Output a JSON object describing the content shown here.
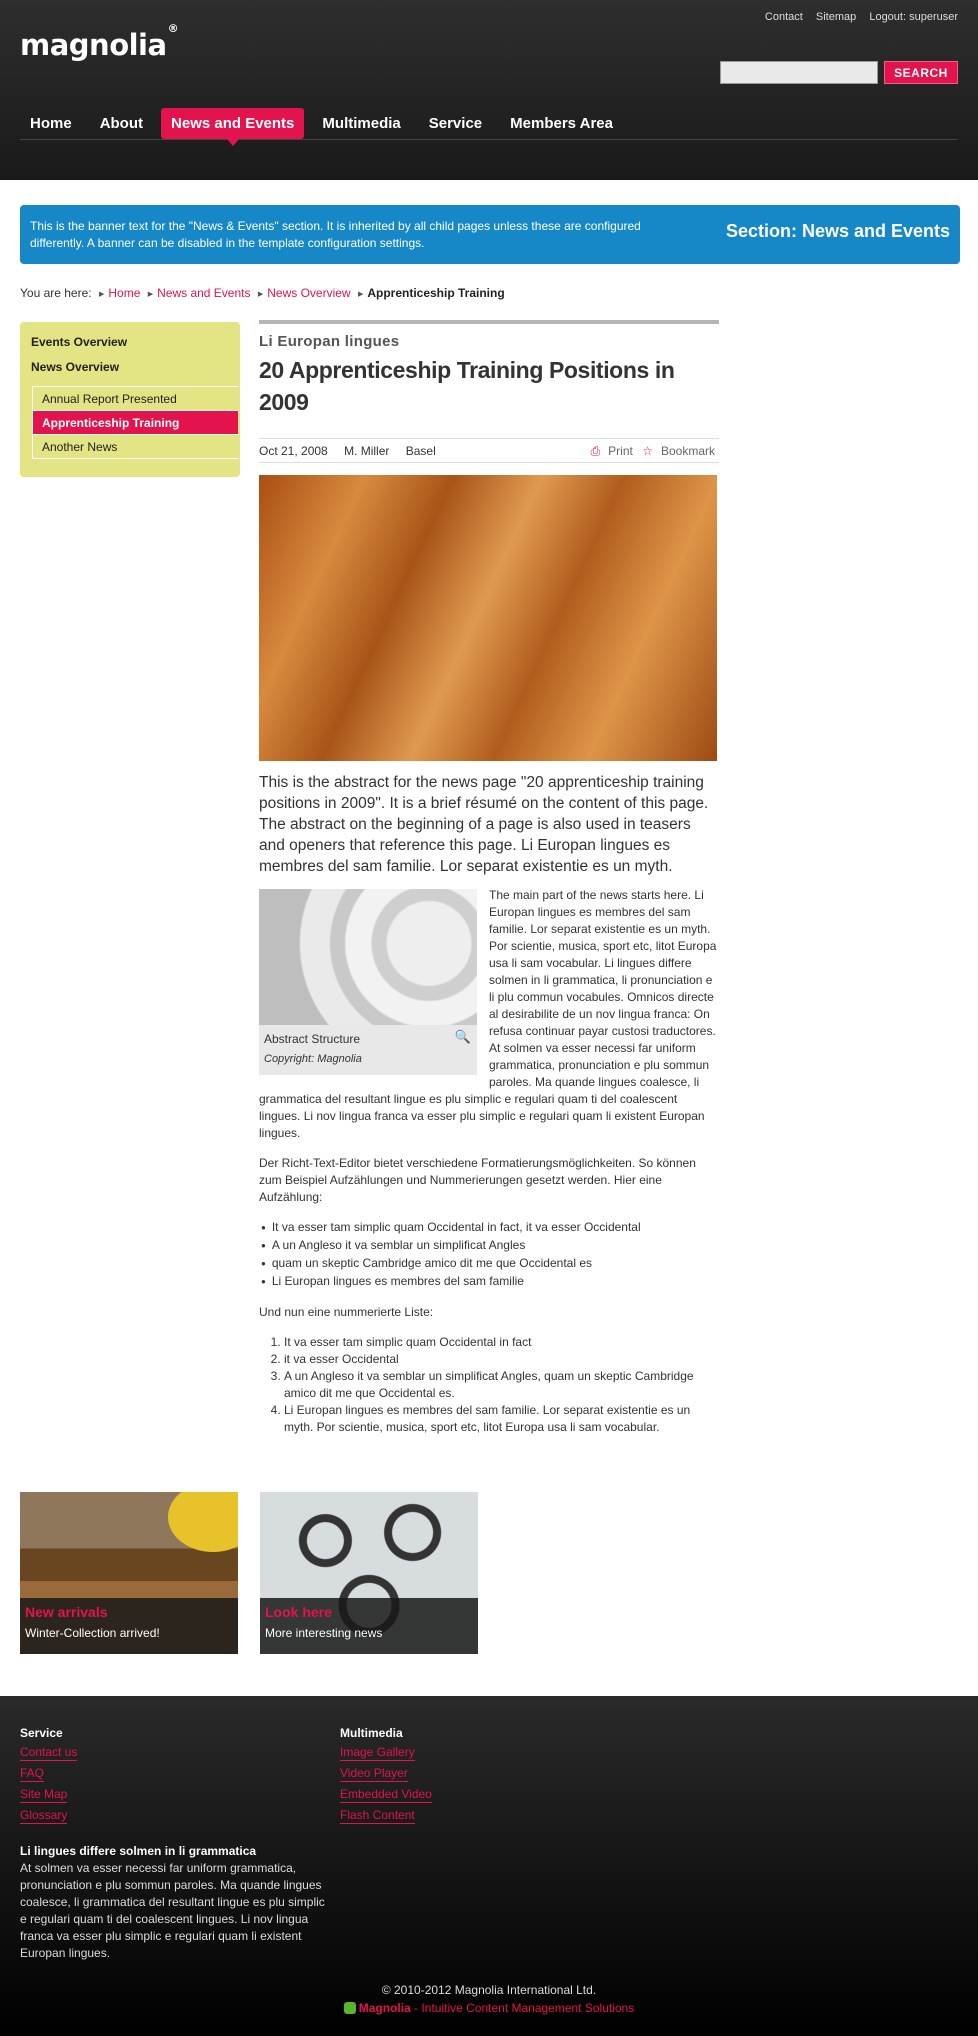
{
  "header": {
    "logo": "magnolia",
    "logo_mark": "®",
    "meta_nav": [
      "Contact",
      "Sitemap",
      "Logout: superuser"
    ],
    "search": {
      "placeholder": "",
      "button": "SEARCH"
    },
    "nav": [
      {
        "label": "Home",
        "active": false
      },
      {
        "label": "About",
        "active": false
      },
      {
        "label": "News and Events",
        "active": true
      },
      {
        "label": "Multimedia",
        "active": false
      },
      {
        "label": "Service",
        "active": false
      },
      {
        "label": "Members Area",
        "active": false
      }
    ]
  },
  "banner": {
    "text": "This is the banner text for the \"News & Events\" section. It is inherited by all child pages unless these are configured differently. A banner can be disabled in the template configuration settings.",
    "section": "Section: News and Events"
  },
  "breadcrumb": {
    "prefix": "You are here:",
    "links": [
      "Home",
      "News and Events",
      "News Overview"
    ],
    "current": "Apprenticeship Training"
  },
  "subnav": {
    "top": [
      "Events Overview",
      "News Overview"
    ],
    "items": [
      "Annual Report Presented",
      "Apprenticeship Training",
      "Another News"
    ],
    "active_index": 1
  },
  "article": {
    "kicker": "Li Europan lingues",
    "title": "20 Apprenticeship Training Positions in 2009",
    "date": "Oct 21, 2008",
    "author": "M. Miller",
    "location": "Basel",
    "print": "Print",
    "bookmark": "Bookmark",
    "abstract": "This is the abstract for the news page \"20 apprenticeship training positions in 2009\". It is a brief résumé on the content of this page. The abstract on the beginning of a page is also used in teasers and openers that reference this page. Li Europan lingues es membres del sam familie. Lor separat existentie es un myth.",
    "figure": {
      "caption": "Abstract Structure",
      "copyright": "Copyright: Magnolia"
    },
    "para1": "The main part of the news starts here. Li Europan lingues es membres del sam familie. Lor separat existentie es un myth. Por scientie, musica, sport etc, litot Europa usa li sam vocabular. Li lingues differe solmen in li grammatica, li pronunciation e li plu commun vocabules. Omnicos directe al desirabilite de un nov lingua franca: On refusa continuar payar custosi traductores. At solmen va esser necessi far uniform grammatica, pronunciation e plu sommun paroles. Ma quande lingues coalesce, li grammatica del resultant lingue es plu simplic e regulari quam ti del coalescent lingues. Li nov lingua franca va esser plu simplic e regulari quam li existent Europan lingues.",
    "para2": "Der Richt-Text-Editor bietet verschiedene Formatierungsmöglichkeiten. So können zum Beispiel Aufzählungen und Nummerierungen gesetzt werden. Hier eine Aufzählung:",
    "bullets": [
      "It va esser tam simplic quam Occidental in fact, it va esser Occidental",
      "A un Angleso it va semblar un simplificat Angles",
      "quam un skeptic Cambridge amico dit me que Occidental es",
      "Li Europan lingues es membres del sam familie"
    ],
    "para3": "Und nun eine nummerierte Liste:",
    "numbered": [
      "It va esser tam simplic quam Occidental in fact",
      "it va esser Occidental",
      "A un Angleso it va semblar un simplificat Angles, quam un skeptic Cambridge amico dit me que Occidental es.",
      "Li Europan lingues es membres del sam familie. Lor separat existentie es un myth. Por scientie, musica, sport etc, litot Europa usa li sam vocabular."
    ]
  },
  "teasers": [
    {
      "title": "New arrivals",
      "text": "Winter-Collection arrived!"
    },
    {
      "title": "Look here",
      "text": "More interesting news"
    }
  ],
  "footer": {
    "col1": {
      "title": "Service",
      "links": [
        "Contact us",
        "FAQ",
        "Site Map",
        "Glossary"
      ]
    },
    "col2": {
      "title": "Multimedia",
      "links": [
        "Image Gallery",
        "Video Player",
        "Embedded Video",
        "Flash Content"
      ]
    },
    "blurb_title": "Li lingues differe solmen in li grammatica",
    "blurb_text": "At solmen va esser necessi far uniform grammatica, pronunciation e plu sommun paroles. Ma quande lingues coalesce, li grammatica del resultant lingue es plu simplic e regulari quam ti del coalescent lingues. Li nov lingua franca va esser plu simplic e regulari quam li existent Europan lingues.",
    "copyright": "© 2010-2012 Magnolia International Ltd.",
    "powered_brand": "Magnolia",
    "powered_text": " - Intuitive Content Management Solutions"
  },
  "colors": {
    "accent": "#e3134e",
    "banner": "#1788c7",
    "subnav": "#e3e483"
  }
}
